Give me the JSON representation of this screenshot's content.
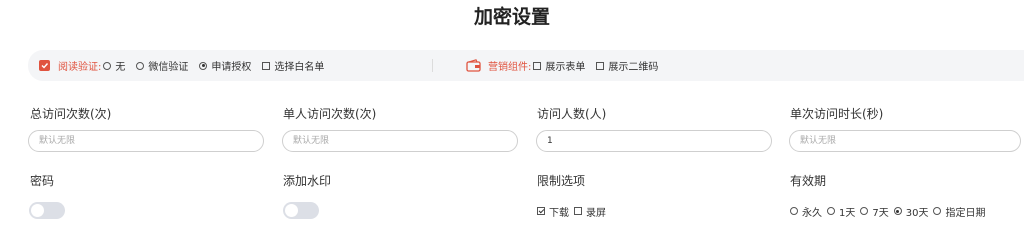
{
  "page": {
    "title": "加密设置"
  },
  "read_verify": {
    "label": "阅读验证:",
    "options": [
      {
        "label": "无",
        "selected": false
      },
      {
        "label": "微信验证",
        "selected": false
      },
      {
        "label": "申请授权",
        "selected": true
      }
    ],
    "whitelist": {
      "label": "选择白名单",
      "checked": false
    }
  },
  "marketing": {
    "label": "营销组件:",
    "options": [
      {
        "label": "展示表单",
        "checked": false
      },
      {
        "label": "展示二维码",
        "checked": false
      }
    ]
  },
  "fields": {
    "total_visits": {
      "label": "总访问次数(次)",
      "value": "",
      "placeholder": "默认无限"
    },
    "single_visits": {
      "label": "单人访问次数(次)",
      "value": "",
      "placeholder": "默认无限"
    },
    "visitors": {
      "label": "访问人数(人)",
      "value": "1",
      "placeholder": ""
    },
    "duration": {
      "label": "单次访问时长(秒)",
      "value": "",
      "placeholder": "默认无限"
    }
  },
  "password": {
    "label": "密码",
    "enabled": false
  },
  "watermark": {
    "label": "添加水印",
    "enabled": false
  },
  "restrictions": {
    "label": "限制选项",
    "options": [
      {
        "label": "下载",
        "checked": true
      },
      {
        "label": "录屏",
        "checked": false
      }
    ]
  },
  "validity": {
    "label": "有效期",
    "options": [
      {
        "label": "永久",
        "selected": false
      },
      {
        "label": "1天",
        "selected": false
      },
      {
        "label": "7天",
        "selected": false
      },
      {
        "label": "30天",
        "selected": true
      },
      {
        "label": "指定日期",
        "selected": false
      }
    ]
  },
  "colors": {
    "accent": "#e0533f",
    "toggle_off": "#dcdfe6",
    "bar_bg": "#f4f5f7"
  },
  "icons": {
    "read_verify": "shield-check-icon",
    "marketing": "wallet-icon"
  }
}
